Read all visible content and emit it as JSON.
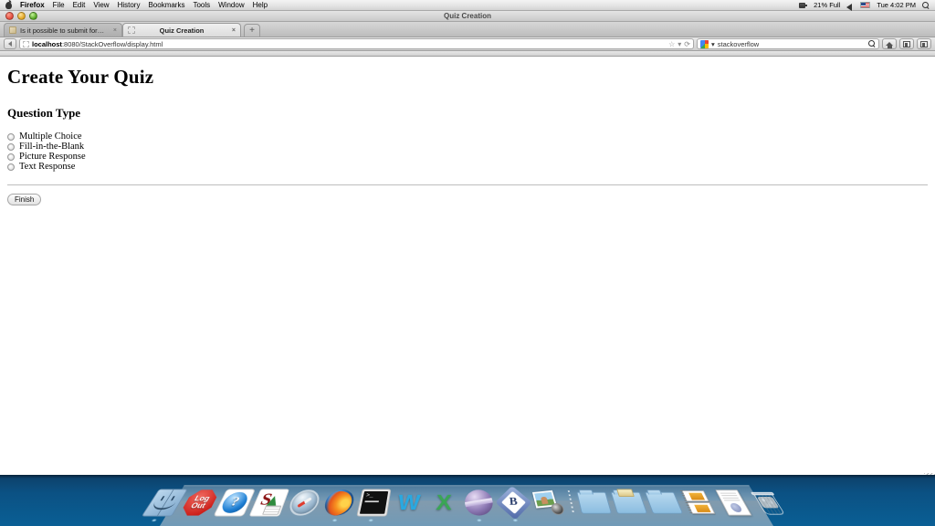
{
  "menubar": {
    "apple_icon": "apple-logo-icon",
    "items": [
      "Firefox",
      "File",
      "Edit",
      "View",
      "History",
      "Bookmarks",
      "Tools",
      "Window",
      "Help"
    ],
    "status": {
      "battery_icon": "battery-icon",
      "battery_text": "21% Full",
      "volume_icon": "volume-icon",
      "flag_icon": "us-flag-icon",
      "clock": "Tue 4:02 PM",
      "spotlight_icon": "search-icon"
    }
  },
  "window": {
    "title": "Quiz Creation",
    "controls": {
      "close": "close-button",
      "minimize": "minimize-button",
      "zoom": "zoom-button"
    }
  },
  "tabs": [
    {
      "label": "Is it possible to submit form inf...",
      "active": false,
      "close": "×"
    },
    {
      "label": "Quiz Creation",
      "active": true,
      "close": "×"
    }
  ],
  "newtab_label": "+",
  "toolbar": {
    "back_label": "",
    "url_host": "localhost",
    "url_path": ":8080/StackOverflow/display.html",
    "url_full": "localhost:8080/StackOverflow/display.html",
    "bookmark_star": "☆",
    "dropdown_caret": "▾",
    "reload_glyph": "⟳",
    "search_value": "stackoverflow",
    "search_engine_icon": "google-icon",
    "search_submit_icon": "search-icon",
    "home_icon": "home-icon",
    "reader_icon": "reader-icon",
    "extra_icon": "tools-icon"
  },
  "page": {
    "h1": "Create Your Quiz",
    "h2": "Question Type",
    "options": [
      {
        "label": "Multiple Choice",
        "checked": false
      },
      {
        "label": "Fill-in-the-Blank",
        "checked": false
      },
      {
        "label": "Picture Response",
        "checked": false
      },
      {
        "label": "Text Response",
        "checked": false
      }
    ],
    "finish_button": "Finish"
  },
  "dock": {
    "items": [
      {
        "name": "finder",
        "label": "Finder",
        "running": true
      },
      {
        "name": "logout",
        "label": "Log Out",
        "line1": "Log",
        "line2": "Out",
        "running": false
      },
      {
        "name": "help",
        "label": "Help",
        "glyph": "?",
        "running": false
      },
      {
        "name": "stanford",
        "label": "Stanford",
        "glyph": "S",
        "running": false
      },
      {
        "name": "safari",
        "label": "Safari",
        "running": false
      },
      {
        "name": "firefox",
        "label": "Firefox",
        "running": true
      },
      {
        "name": "terminal",
        "label": "Terminal",
        "prompt": ">_",
        "running": true
      },
      {
        "name": "microsoft-word",
        "label": "Microsoft Word",
        "glyph": "W",
        "running": false
      },
      {
        "name": "microsoft-excel",
        "label": "Microsoft Excel",
        "glyph": "X",
        "running": false
      },
      {
        "name": "eclipse",
        "label": "Eclipse",
        "running": true
      },
      {
        "name": "bbedit",
        "label": "BBEdit",
        "glyph": "B",
        "running": true
      },
      {
        "name": "iphoto",
        "label": "iPhoto",
        "running": false
      },
      {
        "name": "separator",
        "label": ""
      },
      {
        "name": "folder-1",
        "label": "Folder",
        "running": false
      },
      {
        "name": "folder-documents",
        "label": "Documents",
        "running": false
      },
      {
        "name": "folder-3",
        "label": "Folder",
        "running": false
      },
      {
        "name": "stack-downloads",
        "label": "Downloads",
        "running": false
      },
      {
        "name": "document",
        "label": "Document",
        "running": false
      },
      {
        "name": "trash",
        "label": "Trash",
        "running": false
      }
    ]
  }
}
